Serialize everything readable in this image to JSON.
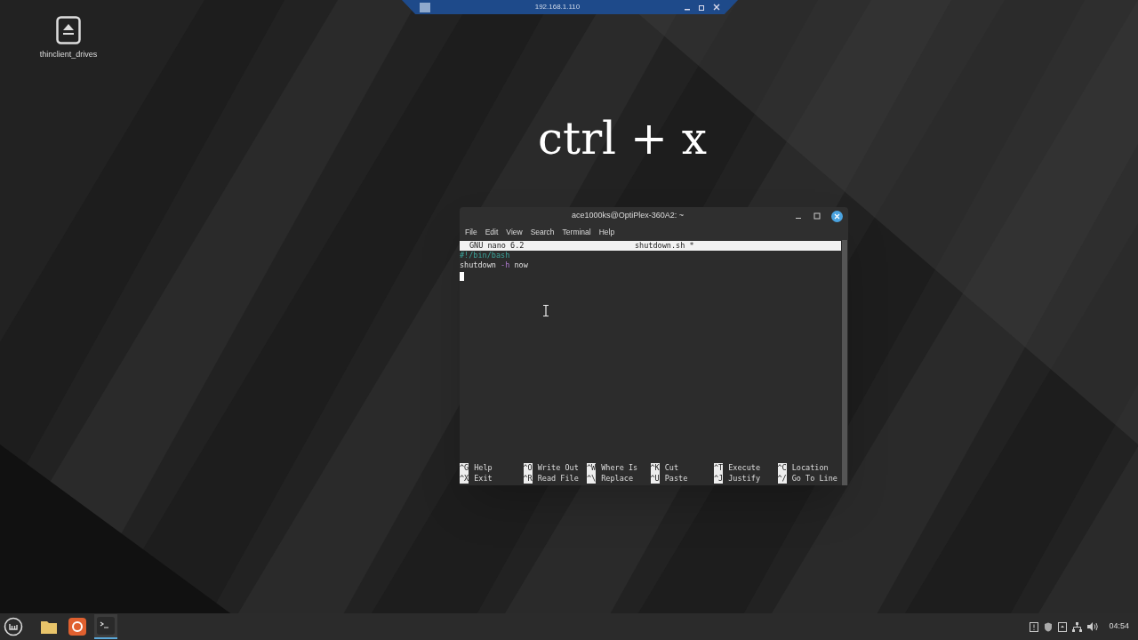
{
  "remote_bar": {
    "title": "192.168.1.110"
  },
  "desktop_icons": [
    {
      "label": "thinclient_drives"
    }
  ],
  "caption": "ctrl + x",
  "terminal": {
    "title": "ace1000ks@OptiPlex-360A2: ~",
    "menu": [
      "File",
      "Edit",
      "View",
      "Search",
      "Terminal",
      "Help"
    ],
    "nano": {
      "version": "GNU nano 6.2",
      "filename": "shutdown.sh *",
      "lines": [
        {
          "segments": [
            {
              "kind": "comment",
              "text": "#!/bin/bash"
            }
          ]
        },
        {
          "segments": [
            {
              "kind": "plain",
              "text": "shutdown "
            },
            {
              "kind": "flag",
              "text": "-h"
            },
            {
              "kind": "plain",
              "text": " now"
            }
          ]
        }
      ],
      "shortcuts": [
        [
          {
            "key": "^G",
            "label": "Help"
          },
          {
            "key": "^O",
            "label": "Write Out"
          },
          {
            "key": "^W",
            "label": "Where Is"
          },
          {
            "key": "^K",
            "label": "Cut"
          },
          {
            "key": "^T",
            "label": "Execute"
          },
          {
            "key": "^C",
            "label": "Location"
          }
        ],
        [
          {
            "key": "^X",
            "label": "Exit"
          },
          {
            "key": "^R",
            "label": "Read File"
          },
          {
            "key": "^\\",
            "label": "Replace"
          },
          {
            "key": "^U",
            "label": "Paste"
          },
          {
            "key": "^J",
            "label": "Justify"
          },
          {
            "key": "^/",
            "label": "Go To Line"
          }
        ]
      ]
    }
  },
  "taskbar": {
    "apps": [
      {
        "kind": "files",
        "selected": false
      },
      {
        "kind": "updater",
        "selected": false
      },
      {
        "kind": "terminal",
        "selected": true
      }
    ],
    "clock": "04:54"
  }
}
